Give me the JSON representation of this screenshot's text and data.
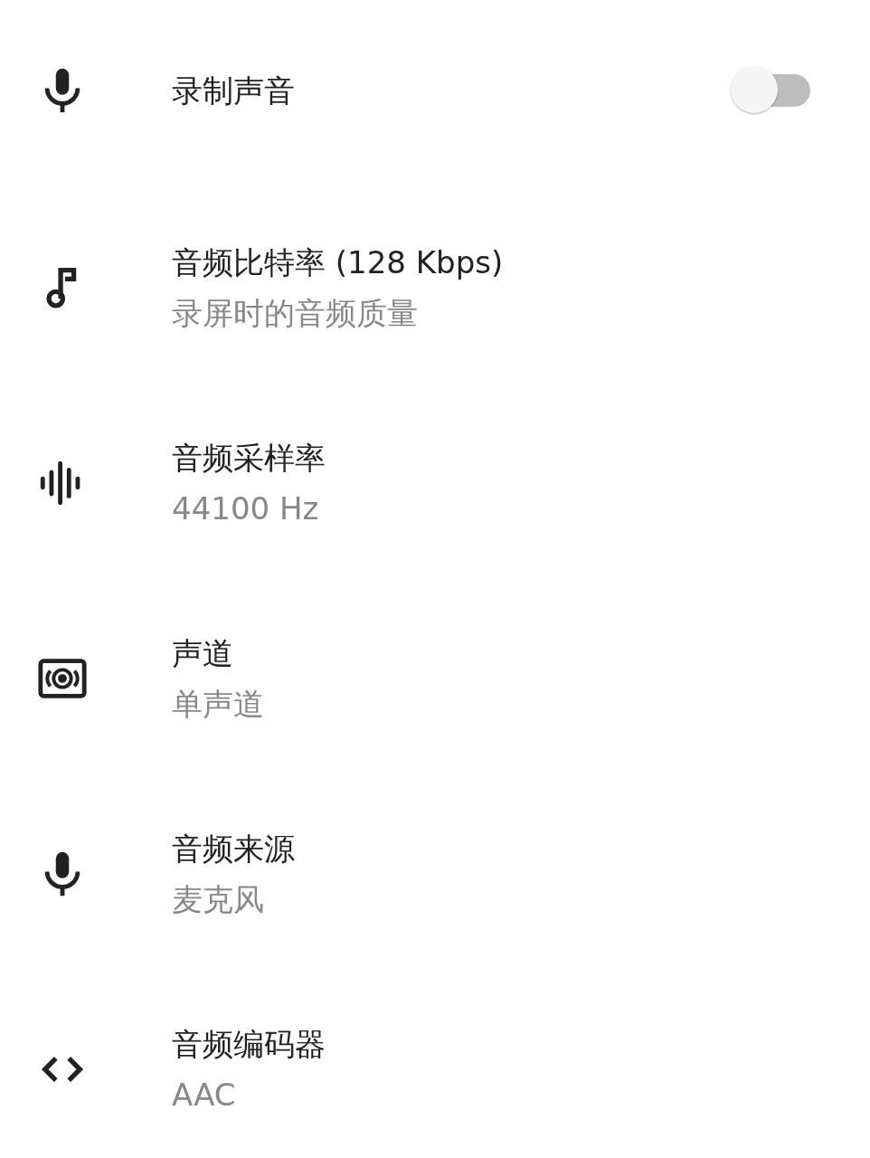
{
  "settings": [
    {
      "title": "录制声音",
      "toggle": {
        "on": false
      }
    },
    {
      "title": "音频比特率 (128 Kbps)",
      "subtitle": "录屏时的音频质量"
    },
    {
      "title": "音频采样率",
      "subtitle": "44100 Hz"
    },
    {
      "title": "声道",
      "subtitle": "单声道"
    },
    {
      "title": "音频来源",
      "subtitle": "麦克风"
    },
    {
      "title": "音频编码器",
      "subtitle": "AAC"
    }
  ]
}
